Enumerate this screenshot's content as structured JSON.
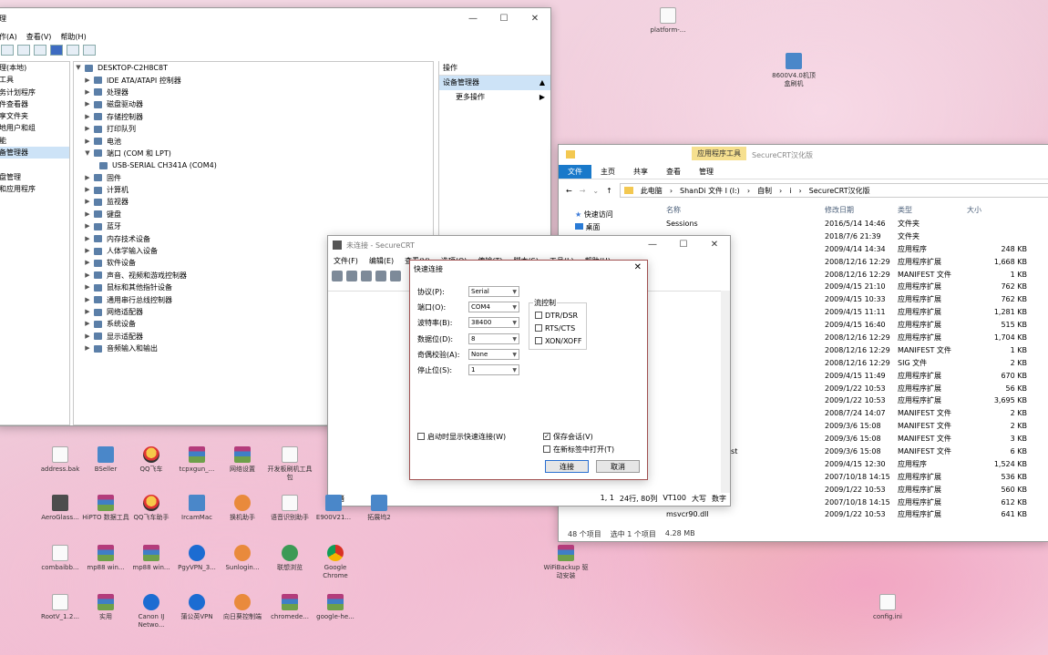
{
  "device_manager": {
    "title": "理",
    "menu": [
      "作(A)",
      "查看(V)",
      "帮助(H)"
    ],
    "left_pane": [
      "理(本地)",
      "工具",
      "务计划程序",
      "件查看器",
      "享文件夹",
      "地用户和组",
      "能",
      "备管理器",
      "",
      "盘管理",
      "和应用程序"
    ],
    "left_selected_index": 7,
    "tree_root": "DESKTOP-C2H8C8T",
    "tree_items": [
      {
        "label": "IDE ATA/ATAPI 控制器",
        "expanded": false
      },
      {
        "label": "处理器",
        "expanded": false
      },
      {
        "label": "磁盘驱动器",
        "expanded": false
      },
      {
        "label": "存储控制器",
        "expanded": false
      },
      {
        "label": "打印队列",
        "expanded": false
      },
      {
        "label": "电池",
        "expanded": false
      },
      {
        "label": "端口 (COM 和 LPT)",
        "expanded": true
      },
      {
        "label": "USB-SERIAL CH341A (COM4)",
        "child": true
      },
      {
        "label": "固件",
        "expanded": false
      },
      {
        "label": "计算机",
        "expanded": false
      },
      {
        "label": "监视器",
        "expanded": false
      },
      {
        "label": "键盘",
        "expanded": false
      },
      {
        "label": "蓝牙",
        "expanded": false
      },
      {
        "label": "内存技术设备",
        "expanded": false
      },
      {
        "label": "人体学输入设备",
        "expanded": false
      },
      {
        "label": "软件设备",
        "expanded": false
      },
      {
        "label": "声音、视频和游戏控制器",
        "expanded": false
      },
      {
        "label": "鼠标和其他指针设备",
        "expanded": false
      },
      {
        "label": "通用串行总线控制器",
        "expanded": false
      },
      {
        "label": "网络适配器",
        "expanded": false
      },
      {
        "label": "系统设备",
        "expanded": false
      },
      {
        "label": "显示适配器",
        "expanded": false
      },
      {
        "label": "音频输入和输出",
        "expanded": false
      }
    ],
    "actions_header": "操作",
    "actions_selected": "设备管理器",
    "actions_more": "更多操作"
  },
  "explorer": {
    "context_tab": "应用程序工具",
    "window_title": "SecureCRT汉化版",
    "tabs": [
      "文件",
      "主页",
      "共享",
      "查看",
      "管理"
    ],
    "breadcrumb": [
      "此电脑",
      "ShanDi 文件 I (I:)",
      "自制",
      "i",
      "SecureCRT汉化版"
    ],
    "nav": [
      "快速访问",
      "桌面"
    ],
    "columns": {
      "name": "名称",
      "date": "修改日期",
      "type": "类型",
      "size": "大小"
    },
    "files": [
      {
        "name": "Sessions",
        "date": "2016/5/14 14:46",
        "type": "文件夹",
        "size": ""
      },
      {
        "name": "",
        "date": "2018/7/6 21:39",
        "type": "文件夹",
        "size": ""
      },
      {
        "name": "",
        "date": "2009/4/14 14:34",
        "type": "应用程序",
        "size": "248 KB"
      },
      {
        "name": "",
        "date": "2008/12/16 12:29",
        "type": "应用程序扩展",
        "size": "1,668 KB"
      },
      {
        "name": "manifest",
        "date": "2008/12/16 12:29",
        "type": "MANIFEST 文件",
        "size": "1 KB"
      },
      {
        "name": "52U.dll",
        "date": "2009/4/15 21:10",
        "type": "应用程序扩展",
        "size": "762 KB"
      },
      {
        "name": "52U_.dll",
        "date": "2009/4/15 10:33",
        "type": "应用程序扩展",
        "size": "762 KB"
      },
      {
        "name": ".dll",
        "date": "2009/4/15 11:11",
        "type": "应用程序扩展",
        "size": "1,281 KB"
      },
      {
        "name": "52U.dll",
        "date": "2009/4/15 16:40",
        "type": "应用程序扩展",
        "size": "515 KB"
      },
      {
        "name": "",
        "date": "2008/12/16 12:29",
        "type": "应用程序扩展",
        "size": "1,704 KB"
      },
      {
        "name": "manifest",
        "date": "2008/12/16 12:29",
        "type": "MANIFEST 文件",
        "size": "1 KB"
      },
      {
        "name": "",
        "date": "2008/12/16 12:29",
        "type": "SIG 文件",
        "size": "2 KB"
      },
      {
        "name": "",
        "date": "2009/4/15 11:49",
        "type": "应用程序扩展",
        "size": "670 KB"
      },
      {
        "name": "",
        "date": "2009/1/22 10:53",
        "type": "应用程序扩展",
        "size": "56 KB"
      },
      {
        "name": "",
        "date": "2009/1/22 10:53",
        "type": "应用程序扩展",
        "size": "3,695 KB"
      },
      {
        "name": "0.CRT.manifest",
        "date": "2008/7/24 14:07",
        "type": "MANIFEST 文件",
        "size": "2 KB"
      },
      {
        "name": "0.CRT.manifest",
        "date": "2009/3/6 15:08",
        "type": "MANIFEST 文件",
        "size": "2 KB"
      },
      {
        "name": "0.MFC.manifest",
        "date": "2009/3/6 15:08",
        "type": "MANIFEST 文件",
        "size": "3 KB"
      },
      {
        "name": "0.MFCLOC.manifest",
        "date": "2009/3/6 15:08",
        "type": "MANIFEST 文件",
        "size": "6 KB"
      },
      {
        "name": "",
        "date": "2009/4/15 12:30",
        "type": "应用程序",
        "size": "1,524 KB"
      },
      {
        "name": "",
        "date": "2007/10/18 14:15",
        "type": "应用程序扩展",
        "size": "536 KB"
      },
      {
        "name": "",
        "date": "2009/1/22 10:53",
        "type": "应用程序扩展",
        "size": "560 KB"
      },
      {
        "name": "",
        "date": "2007/10/18 14:15",
        "type": "应用程序扩展",
        "size": "612 KB"
      },
      {
        "name": "msvcr90.dll",
        "date": "2009/1/22 10:53",
        "type": "应用程序扩展",
        "size": "641 KB"
      }
    ],
    "status_count": "48 个项目",
    "status_selected": "选中 1 个项目",
    "status_size": "4.28 MB"
  },
  "securecrt": {
    "title": "未连接 - SecureCRT",
    "menu": [
      "文件(F)",
      "编辑(E)",
      "查看(V)",
      "选项(O)",
      "传输(T)",
      "脚本(S)",
      "工具(L)",
      "帮助(H)"
    ],
    "status_left": "就绪",
    "status_pos": "1,  1",
    "status_size": "24行, 80列",
    "status_term": "VT100",
    "status_caps": "大写",
    "status_num": "数字"
  },
  "quick_connect": {
    "title": "快速连接",
    "fields": [
      {
        "label": "协议(P):",
        "value": "Serial"
      },
      {
        "label": "端口(O):",
        "value": "COM4"
      },
      {
        "label": "波特率(B):",
        "value": "38400"
      },
      {
        "label": "数据位(D):",
        "value": "8"
      },
      {
        "label": "奇偶校验(A):",
        "value": "None"
      },
      {
        "label": "停止位(S):",
        "value": "1"
      }
    ],
    "flow_control_label": "流控制",
    "flow_options": [
      {
        "label": "DTR/DSR",
        "checked": false
      },
      {
        "label": "RTS/CTS",
        "checked": false
      },
      {
        "label": "XON/XOFF",
        "checked": false
      }
    ],
    "show_on_startup": "启动时显示快速连接(W)",
    "save_session": "保存会话(V)",
    "open_in_tab": "在新标签中打开(T)",
    "connect": "连接",
    "cancel": "取消"
  },
  "desktop_icons": [
    {
      "label": "platform-...",
      "kind": "doc"
    },
    {
      "label": "8600V4.0机顶盒刷机",
      "kind": "app"
    },
    {
      "label": "address.bak",
      "kind": "doc"
    },
    {
      "label": "BSeller",
      "kind": "app"
    },
    {
      "label": "QQ飞车",
      "kind": "qq"
    },
    {
      "label": "tcpxgun_...",
      "kind": "rar"
    },
    {
      "label": "网络设置",
      "kind": "rar"
    },
    {
      "label": "开发板刷机工具包",
      "kind": "doc"
    },
    {
      "label": "AeroGlass...",
      "kind": "film"
    },
    {
      "label": "HiPTO 数据工具",
      "kind": "rar"
    },
    {
      "label": "QQ飞车助手",
      "kind": "qq"
    },
    {
      "label": "IrcamMac",
      "kind": "app"
    },
    {
      "label": "换机助手",
      "kind": "org"
    },
    {
      "label": "语音识别助手",
      "kind": "doc"
    },
    {
      "label": "E900V21...",
      "kind": "app"
    },
    {
      "label": "拓展坞2",
      "kind": "app"
    },
    {
      "label": "combaibb...",
      "kind": "doc"
    },
    {
      "label": "mp88 win...",
      "kind": "rar"
    },
    {
      "label": "mp88 win...",
      "kind": "rar"
    },
    {
      "label": "PgyVPN_3...",
      "kind": "blu"
    },
    {
      "label": "Sunlogin...",
      "kind": "org"
    },
    {
      "label": "联想浏览",
      "kind": "grn"
    },
    {
      "label": "Google Chrome",
      "kind": "chrome"
    },
    {
      "label": "WiFiBackup 驱动安装",
      "kind": "rar"
    },
    {
      "label": "RootV_1.2...",
      "kind": "doc"
    },
    {
      "label": "实用",
      "kind": "rar"
    },
    {
      "label": "Canon IJ Netwo...",
      "kind": "blu"
    },
    {
      "label": "蒲公英VPN",
      "kind": "blu"
    },
    {
      "label": "向日葵控制端",
      "kind": "org"
    },
    {
      "label": "chromede...",
      "kind": "rar"
    },
    {
      "label": "google-he...",
      "kind": "rar"
    },
    {
      "label": "config.ini",
      "kind": "doc"
    }
  ]
}
